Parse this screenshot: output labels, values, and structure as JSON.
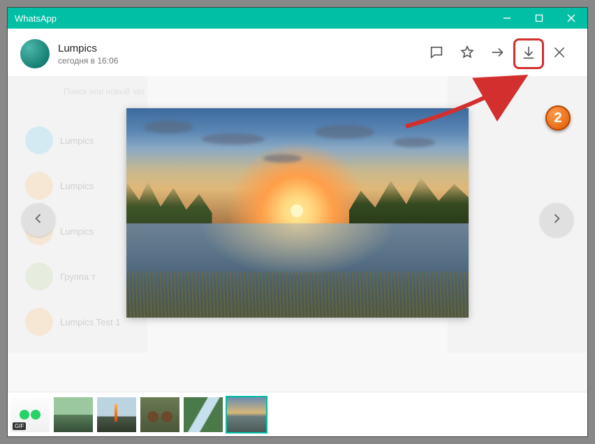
{
  "app": {
    "title": "WhatsApp"
  },
  "window_controls": {
    "minimize": "minimize",
    "maximize": "maximize",
    "close": "close"
  },
  "media_viewer": {
    "sender": "Lumpics",
    "timestamp": "сегодня в 16:06",
    "actions": {
      "reply": "reply",
      "star": "star",
      "forward": "forward",
      "download": "download",
      "close": "close"
    },
    "nav": {
      "prev": "previous",
      "next": "next"
    },
    "thumbnails": [
      {
        "name": "gif-whatsapp",
        "badge": "GIF"
      },
      {
        "name": "forest-aerial"
      },
      {
        "name": "volcano"
      },
      {
        "name": "bears"
      },
      {
        "name": "river-aerial"
      },
      {
        "name": "sunset-lake",
        "selected": true
      }
    ]
  },
  "background_chats": {
    "search_placeholder": "Поиск или новый чат",
    "items": [
      {
        "name": "Lumpics"
      },
      {
        "name": "Lumpics"
      },
      {
        "name": "Lumpics"
      },
      {
        "name": "Группа т"
      },
      {
        "name": "Lumpics Test 1"
      }
    ]
  },
  "annotation": {
    "step": "2"
  }
}
